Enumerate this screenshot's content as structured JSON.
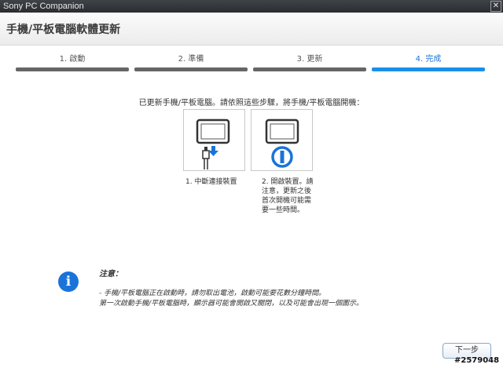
{
  "window": {
    "title": "Sony PC Companion",
    "close_glyph": "✕"
  },
  "header": {
    "title": "手機/平板電腦軟體更新"
  },
  "steps": [
    {
      "label": "1. 啟動",
      "state": "done"
    },
    {
      "label": "2. 準備",
      "state": "done"
    },
    {
      "label": "3. 更新",
      "state": "done"
    },
    {
      "label": "4. 完成",
      "state": "active"
    }
  ],
  "main": {
    "instruction": "已更新手機/平板電腦。請依照這些步驟，將手機/平板電腦開機：",
    "step_cards": [
      {
        "icon": "disconnect-cable-icon",
        "caption": "1. 中斷連接裝置"
      },
      {
        "icon": "power-on-icon",
        "caption": "2. 開啟裝置。請注意，更新之後首次開機可能需要一些時間。"
      }
    ]
  },
  "note": {
    "icon": "info-icon",
    "icon_glyph": "i",
    "title": "注意：",
    "line1": "- 手機/平板電腦正在啟動時，請勿取出電池，啟動可能要花數分鐘時間。",
    "line2": "第一次啟動手機/平板電腦時，顯示器可能會開啟又關閉，以及可能會出現一個圖示。"
  },
  "footer": {
    "next_label": "下一步"
  },
  "watermark": "#2579048",
  "colors": {
    "accent": "#1a8fe8",
    "step_done": "#666666",
    "titlebar": "#2a2d31"
  }
}
